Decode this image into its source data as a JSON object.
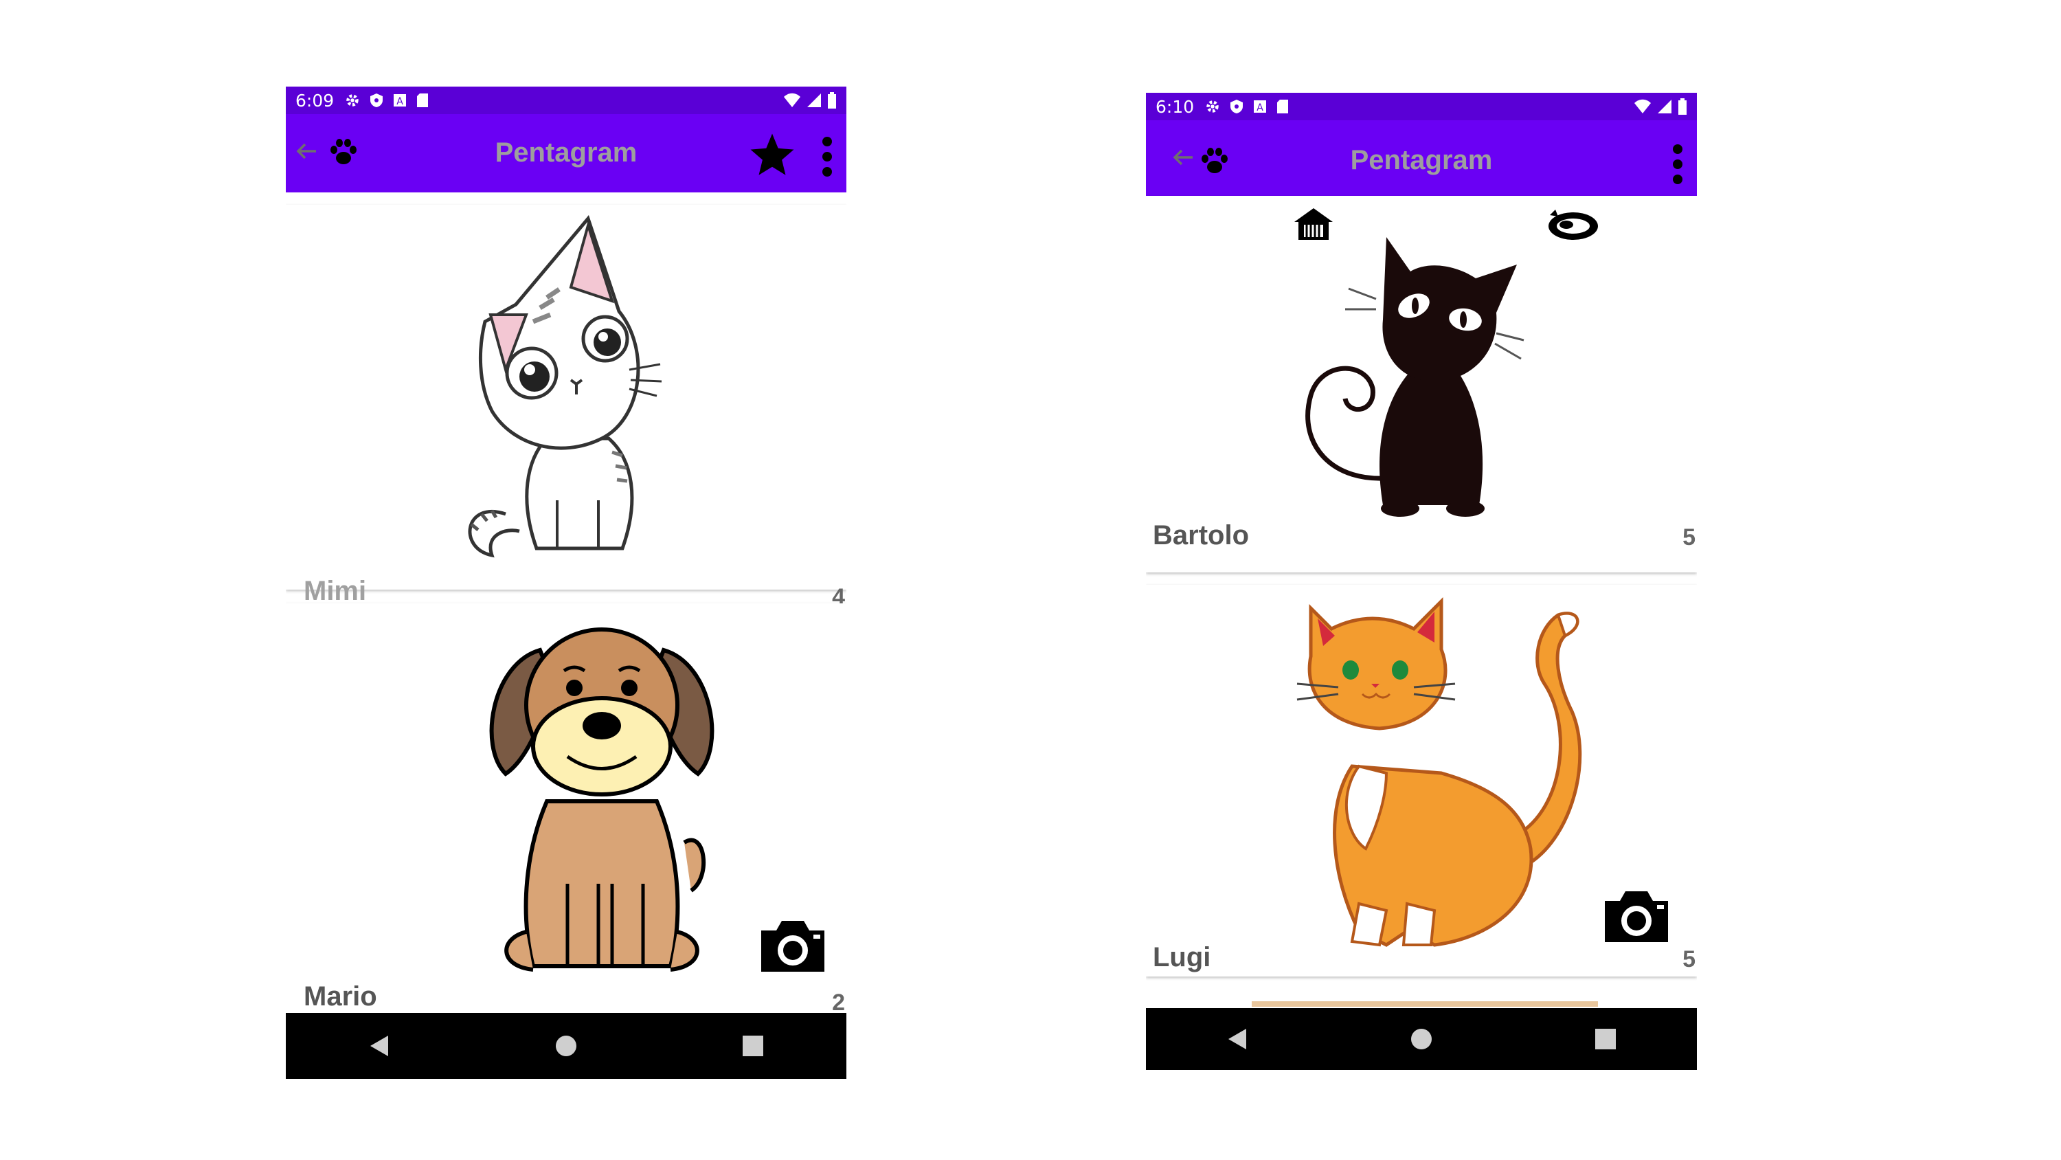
{
  "left_screen": {
    "status": {
      "time": "6:09"
    },
    "app_title": "Pentagram",
    "icons": {
      "back": "arrow-back-icon",
      "logo": "paw-icon",
      "favorite": "star-icon",
      "menu": "more-vert-icon"
    },
    "pets": [
      {
        "name": "Mimi",
        "count": "4",
        "image": "kitten-drawing"
      },
      {
        "name": "Mario",
        "count": "2",
        "image": "puppy-drawing",
        "action_icon": "camera-icon"
      }
    ]
  },
  "right_screen": {
    "status": {
      "time": "6:10"
    },
    "app_title": "Pentagram",
    "icons": {
      "back": "arrow-back-icon",
      "logo": "paw-icon",
      "menu": "more-vert-icon"
    },
    "pets": [
      {
        "name": "Bartolo",
        "count": "5",
        "image": "black-cat-drawing",
        "top_icons": [
          "house-icon",
          "sleeping-pet-icon"
        ]
      },
      {
        "name": "Lugi",
        "count": "5",
        "image": "orange-cat-drawing",
        "action_icon": "camera-icon"
      }
    ]
  },
  "colors": {
    "status_bar": "#5a00d6",
    "app_bar": "#6a00f4",
    "title_text": "#9e9e9e",
    "nav_bar": "#000000"
  }
}
